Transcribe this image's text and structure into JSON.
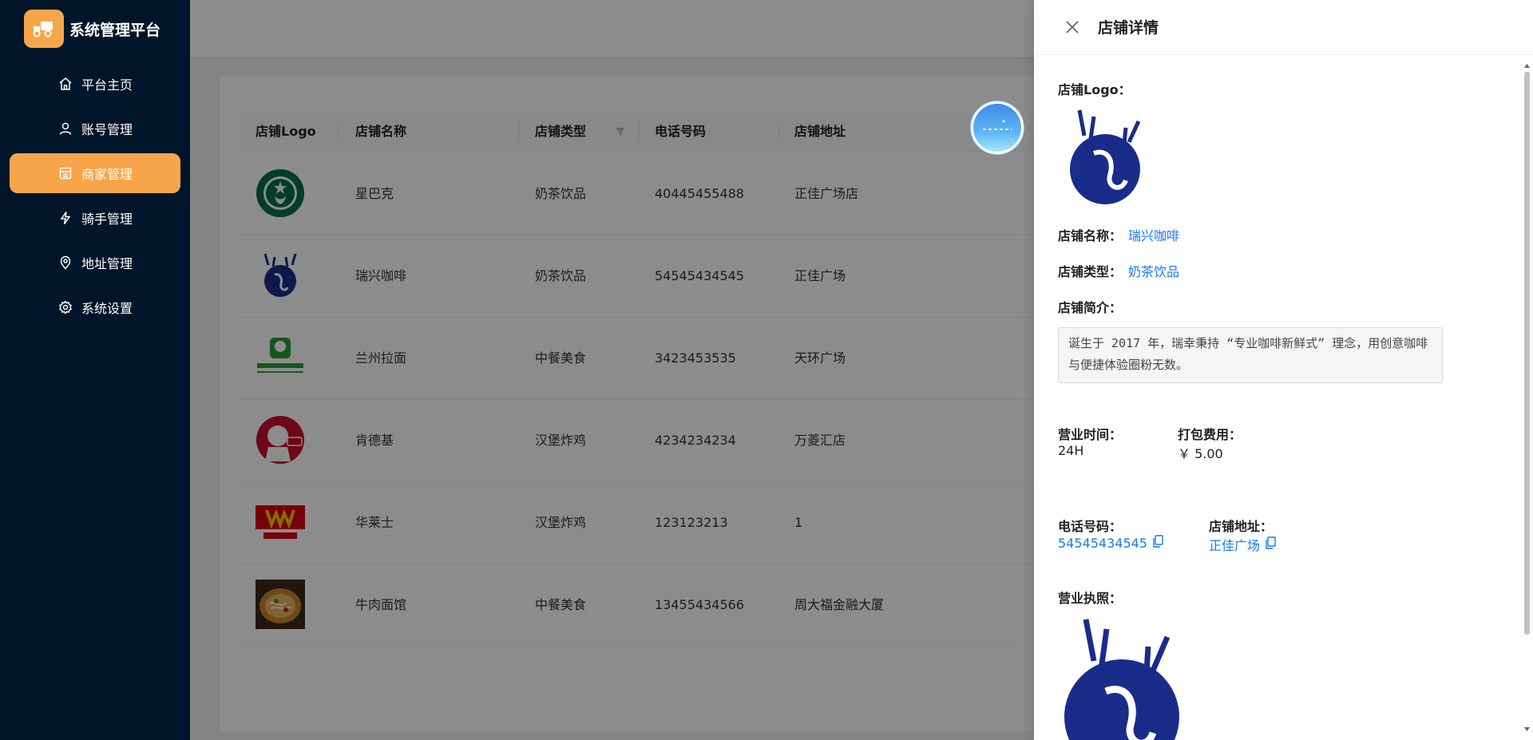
{
  "app": {
    "title": "系统管理平台"
  },
  "sidebar": {
    "items": [
      {
        "label": "平台主页",
        "icon": "home-icon",
        "active": false
      },
      {
        "label": "账号管理",
        "icon": "user-icon",
        "active": false
      },
      {
        "label": "商家管理",
        "icon": "shop-icon",
        "active": true
      },
      {
        "label": "骑手管理",
        "icon": "lightning-icon",
        "active": false
      },
      {
        "label": "地址管理",
        "icon": "location-icon",
        "active": false
      },
      {
        "label": "系统设置",
        "icon": "gear-icon",
        "active": false
      }
    ]
  },
  "table": {
    "headers": [
      "店铺Logo",
      "店铺名称",
      "店铺类型",
      "电话号码",
      "店铺地址"
    ],
    "rows": [
      {
        "logo": "starbucks-logo",
        "name": "星巴克",
        "type": "奶茶饮品",
        "phone": "40445455488",
        "address": "正佳广场店"
      },
      {
        "logo": "luckin-logo",
        "name": "瑞兴咖啡",
        "type": "奶茶饮品",
        "phone": "54545434545",
        "address": "正佳广场"
      },
      {
        "logo": "lanzhou-logo",
        "name": "兰州拉面",
        "type": "中餐美食",
        "phone": "3423453535",
        "address": "天环广场"
      },
      {
        "logo": "kfc-logo",
        "name": "肯德基",
        "type": "汉堡炸鸡",
        "phone": "4234234234",
        "address": "万菱汇店"
      },
      {
        "logo": "wallace-logo",
        "name": "华莱士",
        "type": "汉堡炸鸡",
        "phone": "123123213",
        "address": "1"
      },
      {
        "logo": "noodle-photo",
        "name": "牛肉面馆",
        "type": "中餐美食",
        "phone": "13455434566",
        "address": "周大福金融大厦"
      }
    ]
  },
  "drawer": {
    "title": "店铺详情",
    "logo_label": "店铺Logo：",
    "name_label": "店铺名称：",
    "name_value": "瑞兴咖啡",
    "type_label": "店铺类型：",
    "type_value": "奶茶饮品",
    "intro_label": "店铺简介：",
    "intro_value": "诞生于 2017 年，瑞幸秉持 “专业咖啡新鲜式” 理念，用创意咖啡与便捷体验圈粉无数。",
    "hours_label": "营业时间：",
    "hours_value": "24H",
    "fee_label": "打包费用：",
    "fee_value": "￥ 5.00",
    "phone_label": "电话号码：",
    "phone_value": "54545434545",
    "address_label": "店铺地址：",
    "address_value": "正佳广场",
    "license_label": "营业执照："
  },
  "colors": {
    "accent": "#f7a54a",
    "sidebar_bg": "#001529",
    "link": "#1677ff"
  }
}
